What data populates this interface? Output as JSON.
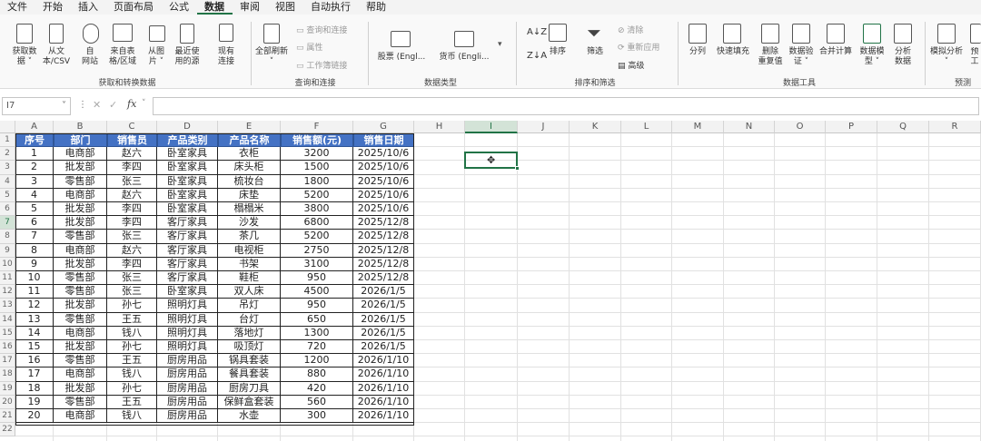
{
  "menu": [
    "文件",
    "开始",
    "插入",
    "页面布局",
    "公式",
    "数据",
    "审阅",
    "视图",
    "自动执行",
    "帮助"
  ],
  "menu_active": "数据",
  "ribbon": {
    "get_data": {
      "btn1": "获取数",
      "btn1b": "据 ˅",
      "btn2": "从文",
      "btn2b": "本/CSV",
      "btn3": "自",
      "btn3b": "网站",
      "btn4": "来自表",
      "btn4b": "格/区域",
      "btn5": "从图",
      "btn5b": "片 ˅",
      "btn6": "最近使",
      "btn6b": "用的源",
      "btn7": "现有",
      "btn7b": "连接",
      "label": "获取和转换数据"
    },
    "queries": {
      "refresh": "全部刷新",
      "refresh_b": "˅",
      "qc": "查询和连接",
      "props": "属性",
      "links": "工作簿链接",
      "label": "查询和连接"
    },
    "types": {
      "stocks": "股票 (Engl...",
      "currency": "货币 (Engli...",
      "label": "数据类型"
    },
    "sort": {
      "sort": "排序",
      "filter": "筛选",
      "clear": "清除",
      "reapply": "重新应用",
      "advanced": "高级",
      "label": "排序和筛选"
    },
    "tools": {
      "split": "分列",
      "flash": "快速填充",
      "dup": "删除",
      "dup_b": "重复值",
      "valid": "数据验",
      "valid_b": "证 ˅",
      "consol": "合并计算",
      "model": "数据模",
      "model_b": "型 ˅",
      "analysis": "分析",
      "analysis_b": "数据",
      "label": "数据工具"
    },
    "forecast": {
      "whatif": "模拟分析",
      "whatif_b": "˅",
      "sheet": "预",
      "sheet_b": "工",
      "label": "预测"
    }
  },
  "formula_bar": {
    "name_box": "I7",
    "fx": "fx"
  },
  "columns": [
    "A",
    "B",
    "C",
    "D",
    "E",
    "F",
    "G",
    "H",
    "I",
    "J",
    "K",
    "L",
    "M",
    "N",
    "O",
    "P",
    "Q",
    "R"
  ],
  "rows": [
    "1",
    "2",
    "3",
    "4",
    "5",
    "6",
    "7",
    "8",
    "9",
    "10",
    "11",
    "12",
    "13",
    "14",
    "15",
    "16",
    "17",
    "18",
    "19",
    "20",
    "21",
    "22"
  ],
  "table": {
    "headers": [
      "序号",
      "部门",
      "销售员",
      "产品类别",
      "产品名称",
      "销售额(元)",
      "销售日期"
    ],
    "rows": [
      [
        "1",
        "电商部",
        "赵六",
        "卧室家具",
        "衣柜",
        "3200",
        "2025/10/6"
      ],
      [
        "2",
        "批发部",
        "李四",
        "卧室家具",
        "床头柜",
        "1500",
        "2025/10/6"
      ],
      [
        "3",
        "零售部",
        "张三",
        "卧室家具",
        "梳妆台",
        "1800",
        "2025/10/6"
      ],
      [
        "4",
        "电商部",
        "赵六",
        "卧室家具",
        "床垫",
        "5200",
        "2025/10/6"
      ],
      [
        "5",
        "批发部",
        "李四",
        "卧室家具",
        "榻榻米",
        "3800",
        "2025/10/6"
      ],
      [
        "6",
        "批发部",
        "李四",
        "客厅家具",
        "沙发",
        "6800",
        "2025/12/8"
      ],
      [
        "7",
        "零售部",
        "张三",
        "客厅家具",
        "茶几",
        "5200",
        "2025/12/8"
      ],
      [
        "8",
        "电商部",
        "赵六",
        "客厅家具",
        "电视柜",
        "2750",
        "2025/12/8"
      ],
      [
        "9",
        "批发部",
        "李四",
        "客厅家具",
        "书架",
        "3100",
        "2025/12/8"
      ],
      [
        "10",
        "零售部",
        "张三",
        "客厅家具",
        "鞋柜",
        "950",
        "2025/12/8"
      ],
      [
        "11",
        "零售部",
        "张三",
        "卧室家具",
        "双人床",
        "4500",
        "2026/1/5"
      ],
      [
        "12",
        "批发部",
        "孙七",
        "照明灯具",
        "吊灯",
        "950",
        "2026/1/5"
      ],
      [
        "13",
        "零售部",
        "王五",
        "照明灯具",
        "台灯",
        "650",
        "2026/1/5"
      ],
      [
        "14",
        "电商部",
        "钱八",
        "照明灯具",
        "落地灯",
        "1300",
        "2026/1/5"
      ],
      [
        "15",
        "批发部",
        "孙七",
        "照明灯具",
        "吸顶灯",
        "720",
        "2026/1/5"
      ],
      [
        "16",
        "零售部",
        "王五",
        "厨房用品",
        "锅具套装",
        "1200",
        "2026/1/10"
      ],
      [
        "17",
        "电商部",
        "钱八",
        "厨房用品",
        "餐具套装",
        "880",
        "2026/1/10"
      ],
      [
        "18",
        "批发部",
        "孙七",
        "厨房用品",
        "厨房刀具",
        "420",
        "2026/1/10"
      ],
      [
        "19",
        "零售部",
        "王五",
        "厨房用品",
        "保鲜盒套装",
        "560",
        "2026/1/10"
      ],
      [
        "20",
        "电商部",
        "钱八",
        "厨房用品",
        "水壶",
        "300",
        "2026/1/10"
      ]
    ]
  },
  "colors": {
    "header_fill": "#4472c4",
    "accent": "#217346"
  }
}
